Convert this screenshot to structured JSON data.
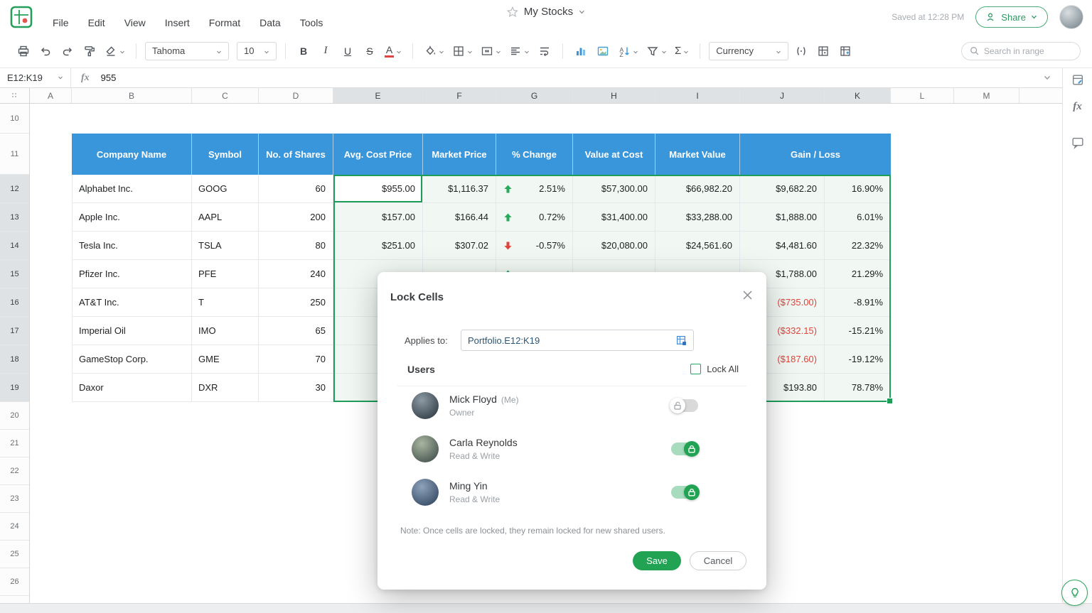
{
  "theme": {
    "accent_green": "#21a353",
    "header_blue": "#3a96db",
    "negative_red": "#e0443c",
    "selection_border": "#1f9d58"
  },
  "menu": {
    "items": [
      "File",
      "Edit",
      "View",
      "Insert",
      "Format",
      "Data",
      "Tools"
    ]
  },
  "titlebar": {
    "title": "My Stocks",
    "saved_status": "Saved at 12:28 PM",
    "share_label": "Share"
  },
  "toolbar": {
    "font_family": "Tahoma",
    "font_size": "10",
    "bold_label": "B",
    "italic_label": "I",
    "underline_label": "U",
    "strikethrough_label": "S",
    "font_color_label": "A",
    "sum_label": "Σ",
    "number_format": "Currency",
    "search_placeholder": "Search in range"
  },
  "formula_bar": {
    "cell_ref": "E12:K19",
    "fx_label": "fx",
    "value": "955"
  },
  "side_rail": {
    "fx_label": "fx"
  },
  "grid": {
    "columns": [
      "A",
      "B",
      "C",
      "D",
      "E",
      "F",
      "G",
      "H",
      "I",
      "J",
      "K",
      "L",
      "M"
    ],
    "rows": [
      "10",
      "11",
      "12",
      "13",
      "14",
      "15",
      "16",
      "17",
      "18",
      "19",
      "20",
      "21",
      "22",
      "23",
      "24",
      "25",
      "26"
    ]
  },
  "table": {
    "headers": [
      "Company Name",
      "Symbol",
      "No. of Shares",
      "Avg. Cost Price",
      "Market Price",
      "% Change",
      "Value at Cost",
      "Market Value",
      "Gain / Loss"
    ],
    "rows": [
      {
        "company": "Alphabet Inc.",
        "symbol": "GOOG",
        "shares": "60",
        "avg_cost": "$955.00",
        "market_price": "$1,116.37",
        "change": "2.51%",
        "trend": "up",
        "value_at_cost": "$57,300.00",
        "market_value": "$66,982.20",
        "gain": "$9,682.20",
        "gain_pct": "16.90%"
      },
      {
        "company": "Apple Inc.",
        "symbol": "AAPL",
        "shares": "200",
        "avg_cost": "$157.00",
        "market_price": "$166.44",
        "change": "0.72%",
        "trend": "up",
        "value_at_cost": "$31,400.00",
        "market_value": "$33,288.00",
        "gain": "$1,888.00",
        "gain_pct": "6.01%"
      },
      {
        "company": "Tesla Inc.",
        "symbol": "TSLA",
        "shares": "80",
        "avg_cost": "$251.00",
        "market_price": "$307.02",
        "change": "-0.57%",
        "trend": "down",
        "value_at_cost": "$20,080.00",
        "market_value": "$24,561.60",
        "gain": "$4,481.60",
        "gain_pct": "22.32%"
      },
      {
        "company": "Pfizer Inc.",
        "symbol": "PFE",
        "shares": "240",
        "avg_cost": "",
        "market_price": "",
        "change": "",
        "trend": "up",
        "value_at_cost": "",
        "market_value": "",
        "gain": "$1,788.00",
        "gain_pct": "21.29%"
      },
      {
        "company": "AT&T Inc.",
        "symbol": "T",
        "shares": "250",
        "avg_cost": "",
        "market_price": "",
        "change": "",
        "trend": "",
        "value_at_cost": "",
        "market_value": "",
        "gain": "($735.00)",
        "gain_pct": "-8.91%"
      },
      {
        "company": "Imperial Oil",
        "symbol": "IMO",
        "shares": "65",
        "avg_cost": "",
        "market_price": "",
        "change": "",
        "trend": "",
        "value_at_cost": "",
        "market_value": "",
        "gain": "($332.15)",
        "gain_pct": "-15.21%"
      },
      {
        "company": "GameStop Corp.",
        "symbol": "GME",
        "shares": "70",
        "avg_cost": "",
        "market_price": "",
        "change": "",
        "trend": "",
        "value_at_cost": "",
        "market_value": "",
        "gain": "($187.60)",
        "gain_pct": "-19.12%"
      },
      {
        "company": "Daxor",
        "symbol": "DXR",
        "shares": "30",
        "avg_cost": "",
        "market_price": "",
        "change": "",
        "trend": "",
        "value_at_cost": "",
        "market_value": "",
        "gain": "$193.80",
        "gain_pct": "78.78%"
      }
    ]
  },
  "dialog": {
    "title": "Lock Cells",
    "applies_to_label": "Applies to:",
    "applies_to_value": "Portfolio.E12:K19",
    "users_label": "Users",
    "lock_all_label": "Lock All",
    "users": [
      {
        "name": "Mick Floyd",
        "suffix": "(Me)",
        "role": "Owner"
      },
      {
        "name": "Carla Reynolds",
        "suffix": "",
        "role": "Read & Write"
      },
      {
        "name": "Ming Yin",
        "suffix": "",
        "role": "Read & Write"
      }
    ],
    "note": "Note:  Once cells are locked, they remain locked for new shared users.",
    "save_label": "Save",
    "cancel_label": "Cancel"
  }
}
